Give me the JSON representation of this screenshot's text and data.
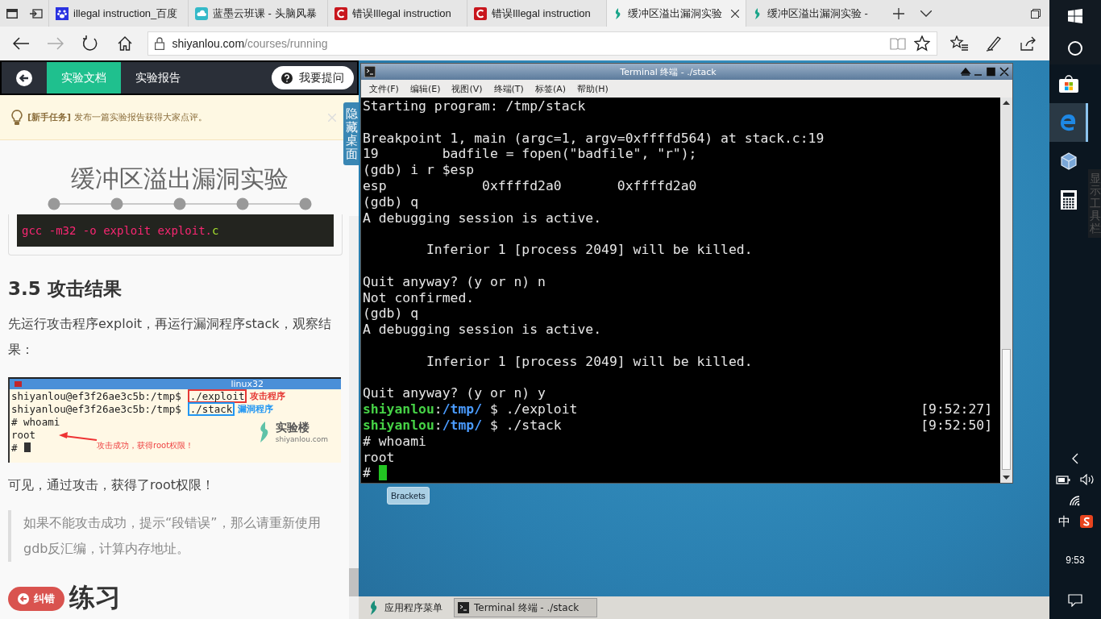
{
  "browser": {
    "tabs": [
      {
        "kind": "paw",
        "title": "illegal instruction_百度",
        "selected": false
      },
      {
        "kind": "cloud",
        "title": "蓝墨云班课 - 头脑风暴",
        "selected": false
      },
      {
        "kind": "c",
        "title": "错误Illegal instruction",
        "selected": false
      },
      {
        "kind": "c",
        "title": "错误Illegal instruction",
        "selected": false
      },
      {
        "kind": "leaf",
        "title": "缓冲区溢出漏洞实验",
        "selected": true
      },
      {
        "kind": "leaf",
        "title": "缓冲区溢出漏洞实验 -",
        "selected": false
      }
    ],
    "address": {
      "domain": "shiyanlou.com",
      "path": "/courses/running"
    }
  },
  "doc": {
    "nav_tabs": [
      {
        "label": "实验文档",
        "selected": true
      },
      {
        "label": "实验报告",
        "selected": false
      }
    ],
    "ask_button": "我要提问",
    "notice": "**[新手任务]** 发布一篇实验报告获得大家点评。",
    "hide_desktop": "隐藏桌面",
    "title": "缓冲区溢出漏洞实验",
    "code": [
      {
        "text": "gcc -m32 -o exploit exploit.",
        "color": "#f92672"
      },
      {
        "text": "c",
        "color": "#a6e22e"
      }
    ],
    "heading": "3.5 攻击结果",
    "paragraph": "先运行攻击程序exploit，再运行漏洞程序stack，观察结果：",
    "figure": {
      "title": "linux32",
      "lines": [
        {
          "prompt": "shiyanlou@ef3f26ae3c5b:/tmp$",
          "command": "./exploit",
          "label": "攻击程序",
          "color": "#e53935"
        },
        {
          "prompt": "shiyanlou@ef3f26ae3c5b:/tmp$",
          "command": "./stack",
          "label": "漏洞程序",
          "color": "#2196f3"
        }
      ],
      "output": [
        "# whoami",
        "root",
        "#"
      ],
      "arrow_label": "攻击成功，获得root权限！",
      "logo": "实验楼",
      "logo_url": "shiyanlou.com"
    },
    "result": "可见，通过攻击，获得了root权限！",
    "note": "如果不能攻击成功，提示“段错误”，那么请重新使用gdb反汇编，计算内存地址。",
    "next_heading": "练习",
    "report_button": "纠错"
  },
  "terminal": {
    "title": "Terminal 终端 - ./stack",
    "menu": [
      "文件(F)",
      "编辑(E)",
      "视图(V)",
      "终端(T)",
      "标签(A)",
      "帮助(H)"
    ],
    "lines": [
      {
        "kind": "text",
        "text": "Starting program: /tmp/stack"
      },
      {
        "kind": "blank"
      },
      {
        "kind": "text",
        "text": "Breakpoint 1, main (argc=1, argv=0xffffd564) at stack.c:19"
      },
      {
        "kind": "text",
        "text": "19\t  badfile = fopen(\"badfile\", \"r\");"
      },
      {
        "kind": "text",
        "text": "(gdb) i r $esp"
      },
      {
        "kind": "text",
        "text": "esp            0xffffd2a0\t0xffffd2a0"
      },
      {
        "kind": "text",
        "text": "(gdb) q"
      },
      {
        "kind": "text",
        "text": "A debugging session is active."
      },
      {
        "kind": "blank"
      },
      {
        "kind": "text",
        "text": "\tInferior 1 [process 2049] will be killed."
      },
      {
        "kind": "blank"
      },
      {
        "kind": "text",
        "text": "Quit anyway? (y or n) n"
      },
      {
        "kind": "text",
        "text": "Not confirmed."
      },
      {
        "kind": "text",
        "text": "(gdb) q"
      },
      {
        "kind": "text",
        "text": "A debugging session is active."
      },
      {
        "kind": "blank"
      },
      {
        "kind": "text",
        "text": "\tInferior 1 [process 2049] will be killed."
      },
      {
        "kind": "blank"
      },
      {
        "kind": "text",
        "text": "Quit anyway? (y or n) y"
      },
      {
        "kind": "prompt",
        "user": "shiyanlou",
        "sep": ":",
        "path": "/tmp/",
        "command": " $ ./exploit",
        "time": "[9:52:27]"
      },
      {
        "kind": "prompt",
        "user": "shiyanlou",
        "sep": ":",
        "path": "/tmp/",
        "command": " $ ./stack",
        "time": "[9:52:50]"
      },
      {
        "kind": "text",
        "text": "# whoami"
      },
      {
        "kind": "text",
        "text": "root"
      },
      {
        "kind": "cursor",
        "text": "#"
      }
    ]
  },
  "desktop": {
    "icons": [
      "Brackets"
    ],
    "menu": "应用程序菜单",
    "tasks": [
      "Terminal 终端 - ./stack"
    ]
  },
  "win_taskbar": {
    "apps": [
      {
        "kind": "store",
        "selected": false
      },
      {
        "kind": "edge",
        "selected": true
      },
      {
        "kind": "box",
        "selected": false
      },
      {
        "kind": "calc",
        "selected": false
      }
    ],
    "tooltip": "显示工具栏",
    "ime": "中",
    "time": "9:53"
  }
}
